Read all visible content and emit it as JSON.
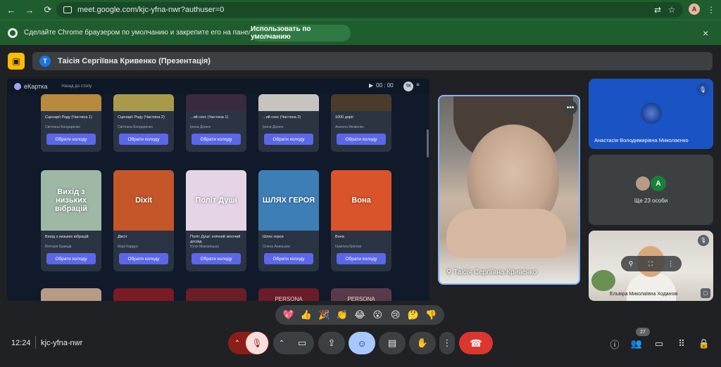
{
  "browser": {
    "url": "meet.google.com/kjc-yfna-nwr?authuser=0",
    "profile_initial": "A"
  },
  "infobar": {
    "text": "Сделайте Chrome браузером по умолчанию и закрепите его на панели задач.",
    "button_label": "Использовать по умолчанию",
    "close_label": "×"
  },
  "meet": {
    "presenter_initial": "T",
    "presenter_banner": "Таісія Сергіївна Кривенко (Презентація)",
    "clock": "12:24",
    "meeting_code": "kjc-yfna-nwr",
    "people_count": "27"
  },
  "shared_app": {
    "logo_text": "еКартка",
    "back_label": "Назад до столу",
    "timer": "00 : 00",
    "avatar_initials": "ТК",
    "decks_row1": [
      {
        "title": "Сценарії Роду (Частина 1)",
        "author": "Світлана Бондаренко",
        "button": "Обрати колоду",
        "cover": "#b88a3d"
      },
      {
        "title": "Сценарії Роду (Частина 2)",
        "author": "Світлана Бондаренко",
        "button": "Обрати колоду",
        "cover": "#a89a4a"
      },
      {
        "title": "...ий секс (Частина 1)",
        "author": "Ірина Дерюн",
        "button": "Обрати колоду",
        "cover": "#3a2a3f"
      },
      {
        "title": "...ий секс (Частина 2)",
        "author": "Ірина Дерюн",
        "button": "Обрати колоду",
        "cover": "#c7c4c0"
      },
      {
        "title": "1000 доріг",
        "author": "Анжела Яковенко",
        "button": "Обрати колоду",
        "cover": "#4a3b2a"
      }
    ],
    "decks_row2": [
      {
        "title": "Вихід з низьких вібрацій",
        "author": "Вікторія Кравців",
        "button": "Обрати колоду",
        "cover_text": "Вихід з низьких вібрацій",
        "cover": "#9fb8a6"
      },
      {
        "title": "Діксіт",
        "author": "Марі Кардуа",
        "button": "Обрати колоду",
        "cover_text": "Dixit",
        "cover": "#c4562a"
      },
      {
        "title": "Політ Душі: епічний жіночий досвід",
        "author": "Юлія Маковецька",
        "button": "Обрати колоду",
        "cover_text": "Політ Душі",
        "cover": "#e4d4e6"
      },
      {
        "title": "Шлях героя",
        "author": "Олена Ананьєва",
        "button": "Обрати колоду",
        "cover_text": "ШЛЯХ ГЕРОЯ",
        "cover": "#3d7fb5"
      },
      {
        "title": "Вона",
        "author": "Камілла Кріогер",
        "button": "Обрати колоду",
        "cover_text": "Вона",
        "cover": "#d9532b"
      }
    ],
    "row3_covers": [
      "#b79b85",
      "#7a1a22",
      "#6a1e28",
      "#6c1c26",
      "#5a3a4a"
    ],
    "row3_texts": [
      "",
      "",
      "",
      "PERSONA",
      "PERSONA"
    ]
  },
  "participants": {
    "main_name": "Таісія Сергіївна Кривенко",
    "tile1_name": "Анастасія Володимирівна Миколаєнко",
    "others_initial": "A",
    "others_label": "Ще 23 особи",
    "tile3_name": "Ельвіра Миколаївна Ходанові"
  },
  "reactions": [
    "💖",
    "👍",
    "🎉",
    "👏",
    "😂",
    "😮",
    "😢",
    "🤔",
    "👎"
  ]
}
